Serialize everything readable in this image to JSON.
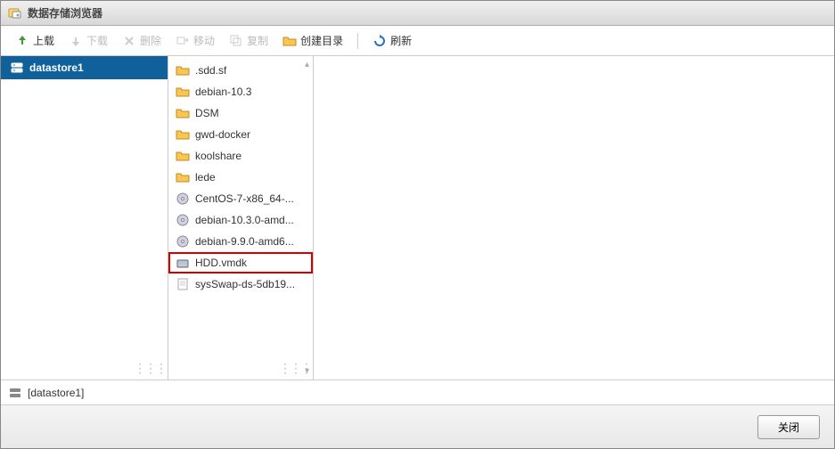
{
  "window": {
    "title": "数据存储浏览器"
  },
  "toolbar": {
    "upload": "上载",
    "download": "下载",
    "delete": "删除",
    "move": "移动",
    "copy": "复制",
    "create_dir": "创建目录",
    "refresh": "刷新"
  },
  "datastores": {
    "items": [
      {
        "name": "datastore1"
      }
    ]
  },
  "files": {
    "items": [
      {
        "name": ".sdd.sf",
        "type": "folder"
      },
      {
        "name": "debian-10.3",
        "type": "folder"
      },
      {
        "name": "DSM",
        "type": "folder"
      },
      {
        "name": "gwd-docker",
        "type": "folder"
      },
      {
        "name": "koolshare",
        "type": "folder"
      },
      {
        "name": "lede",
        "type": "folder"
      },
      {
        "name": "CentOS-7-x86_64-...",
        "type": "iso"
      },
      {
        "name": "debian-10.3.0-amd...",
        "type": "iso"
      },
      {
        "name": "debian-9.9.0-amd6...",
        "type": "iso"
      },
      {
        "name": "HDD.vmdk",
        "type": "disk",
        "highlighted": true
      },
      {
        "name": "sysSwap-ds-5db19...",
        "type": "file"
      }
    ]
  },
  "breadcrumb": {
    "path": "[datastore1]"
  },
  "footer": {
    "close": "关闭"
  }
}
